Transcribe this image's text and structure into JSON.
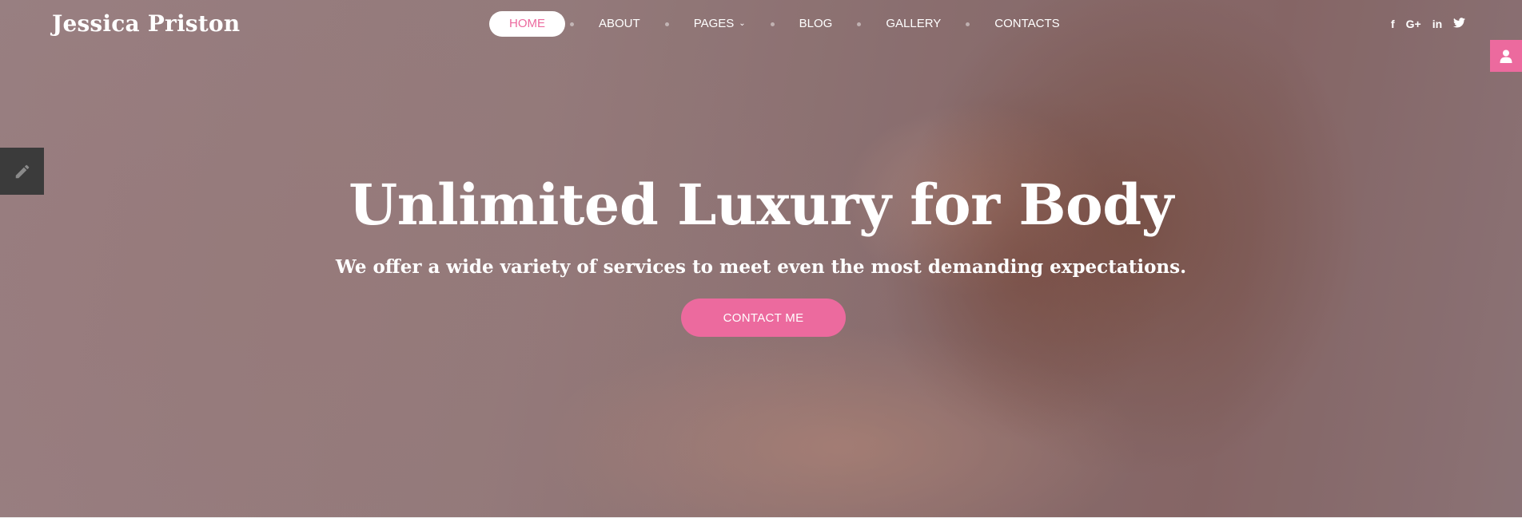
{
  "site": {
    "logo": "Jessica Priston"
  },
  "nav": {
    "items": [
      {
        "label": "HOME",
        "active": true
      },
      {
        "label": "ABOUT"
      },
      {
        "label": "PAGES",
        "has_dropdown": true
      },
      {
        "label": "BLOG"
      },
      {
        "label": "GALLERY"
      },
      {
        "label": "CONTACTS"
      }
    ]
  },
  "social": {
    "facebook": "f",
    "googleplus": "G+",
    "linkedin": "in",
    "twitter": "twitter-icon"
  },
  "hero": {
    "title": "Unlimited Luxury for Body",
    "subtitle": "We offer a wide variety of services to meet even the most demanding expectations.",
    "cta_label": "CONTACT ME"
  },
  "colors": {
    "accent": "#ec6a9e",
    "edit_tab": "#3b3b3b",
    "text": "#ffffff"
  }
}
